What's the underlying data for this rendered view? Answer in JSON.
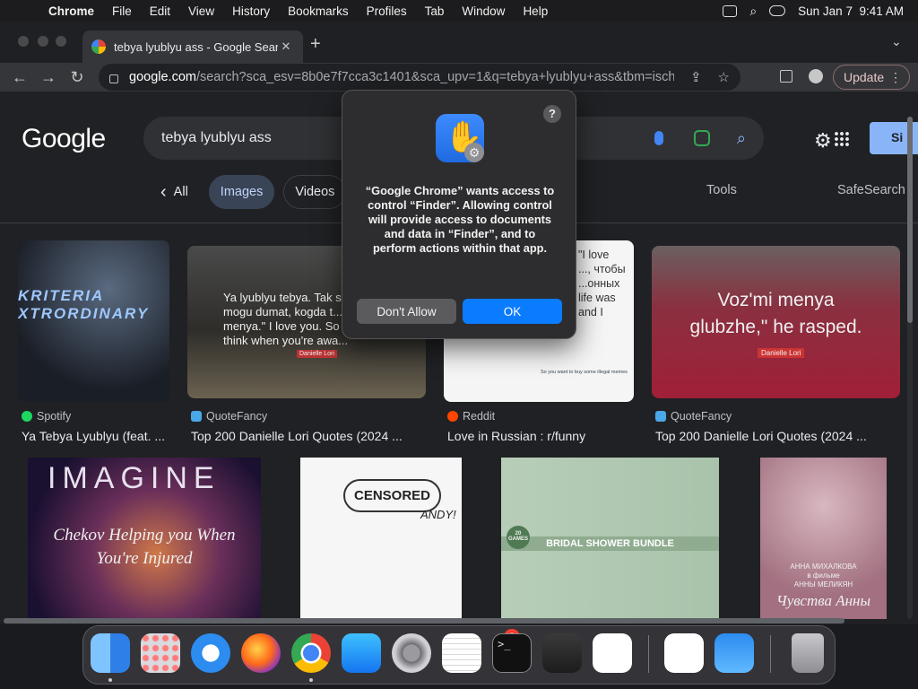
{
  "menubar": {
    "app": "Chrome",
    "items": [
      "File",
      "Edit",
      "View",
      "History",
      "Bookmarks",
      "Profiles",
      "Tab",
      "Window",
      "Help"
    ],
    "datetime": "Sun Jan 7  9:41 AM"
  },
  "tab": {
    "title": "tebya lyublyu ass - Google Search",
    "close": "✕",
    "new": "+"
  },
  "toolbar": {
    "url_host": "google.com",
    "url_path": "/search?sca_esv=8b0e7f7cca3c1401&sca_upv=1&q=tebya+lyublyu+ass&tbm=isch...",
    "update_label": "Update"
  },
  "google": {
    "logo": "Google",
    "query": "tebya lyublyu ass",
    "signin_label": "Si",
    "filters": {
      "back": "‹",
      "all": "All",
      "images": "Images",
      "videos": "Videos"
    },
    "tools": "Tools",
    "safesearch": "SafeSearch"
  },
  "results": [
    {
      "source": "Spotify",
      "title": "Ya Tebya Lyublyu (feat. ...",
      "overlay": "KRITERIA\nXTRORDINARY",
      "favcolor": "#1ed760"
    },
    {
      "source": "QuoteFancy",
      "title": "Top 200 Danielle Lori Quotes (2024 ...",
      "overlay": "Ya lyublyu tebya. Tak s...\nmogu dumat, kogda t...\nmenya.\" I love you. So f...\nthink when you're awa...",
      "credit": "Danielle Lori",
      "favcolor": "#4aa8e8"
    },
    {
      "source": "Reddit",
      "title": "Love in Russian : r/funny",
      "overlay": "\"I love\n..., чтобы\n...онных\nlife was\nand I",
      "snippet": "So you want to buy some illegal memes",
      "favcolor": "#ff4500"
    },
    {
      "source": "QuoteFancy",
      "title": "Top 200 Danielle Lori Quotes (2024 ...",
      "overlay": "Voz'mi menya\nglubzhe,\" he rasped.",
      "credit": "Danielle Lori",
      "favcolor": "#4aa8e8"
    }
  ],
  "row2": {
    "imagine": "IMAGINE",
    "imagine_sub": "Chekov Helping you When\nYou're Injured",
    "censored": "CENSORED",
    "andy": "ANDY!",
    "bridal": "BRIDAL SHOWER BUNDLE",
    "games": "20\nGAMES",
    "book_author": "АННА МИХАЛКОВА\nв фильме\nАННЫ МЕЛИКЯН",
    "book_title": "Чувства Анны"
  },
  "dialog": {
    "help": "?",
    "message": "“Google Chrome” wants access to control “Finder”. Allowing control will provide access to documents and data in “Finder”, and to perform actions within that app.",
    "dont_allow": "Don't Allow",
    "ok": "OK"
  },
  "dock": {
    "apps": [
      "Finder",
      "Launchpad",
      "Safari",
      "Firefox",
      "Google Chrome",
      "App Store",
      "System Settings",
      "TextEdit",
      "Terminal",
      "GarageBand",
      "Visual Studio Code",
      "Visual Studio",
      "Weather",
      "Trash"
    ],
    "settings_badge": "2"
  }
}
